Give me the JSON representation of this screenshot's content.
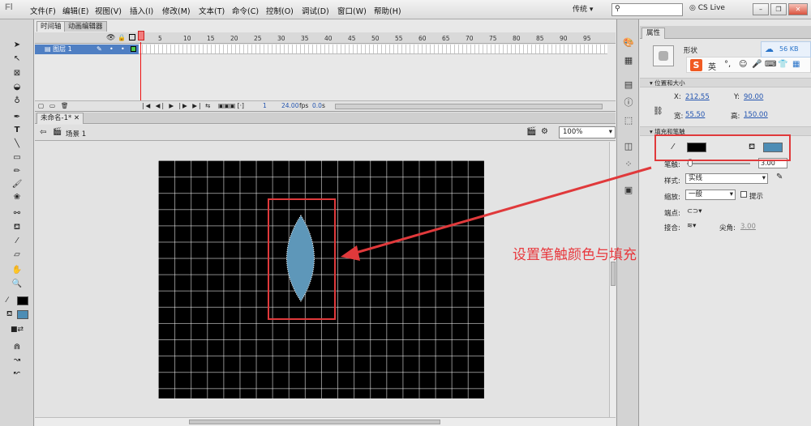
{
  "app": {
    "logo": "Fl"
  },
  "menu": [
    "文件(F)",
    "编辑(E)",
    "视图(V)",
    "插入(I)",
    "修改(M)",
    "文本(T)",
    "命令(C)",
    "控制(O)",
    "调试(D)",
    "窗口(W)",
    "帮助(H)"
  ],
  "topbar": {
    "workspace": "传统",
    "cslive": "CS Live"
  },
  "timeline": {
    "tabs": [
      "时间轴",
      "动画编辑器"
    ],
    "ticks": [
      "1",
      "5",
      "10",
      "15",
      "20",
      "25",
      "30",
      "35",
      "40",
      "45",
      "50",
      "55",
      "60",
      "65",
      "70",
      "75",
      "80",
      "85",
      "90",
      "95"
    ],
    "layer_name": "图层 1",
    "bottom": {
      "frame": "1",
      "fps": "24.00",
      "fps_unit": "fps",
      "time": "0.0",
      "time_unit": "s"
    }
  },
  "document": {
    "tab": "未命名-1*",
    "scene": "场景 1",
    "zoom": "100%"
  },
  "properties": {
    "tab": "属性",
    "type": "形状",
    "file_size": "56 KB",
    "ime_label": "英",
    "sections": {
      "position": "位置和大小",
      "fill": "填充和笔触"
    },
    "x_label": "X:",
    "x": "212.55",
    "y_label": "Y:",
    "y": "90.00",
    "w_label": "宽:",
    "w": "55.50",
    "h_label": "高:",
    "h": "150.00",
    "stroke_color": "#000000",
    "fill_color": "#4d8db5",
    "stroke_label": "笔触:",
    "stroke_value": "3.00",
    "style_label": "样式:",
    "style_value": "实线",
    "scale_label": "缩放:",
    "scale_value": "一般",
    "hint_label": "提示",
    "cap_label": "端点:",
    "join_label": "接合:",
    "miter_label": "尖角:",
    "miter_value": "3.00"
  },
  "annotation": {
    "text": "设置笔触颜色与填充",
    "color": "#e8383d"
  },
  "shape": {
    "fill": "#5e97b9"
  }
}
